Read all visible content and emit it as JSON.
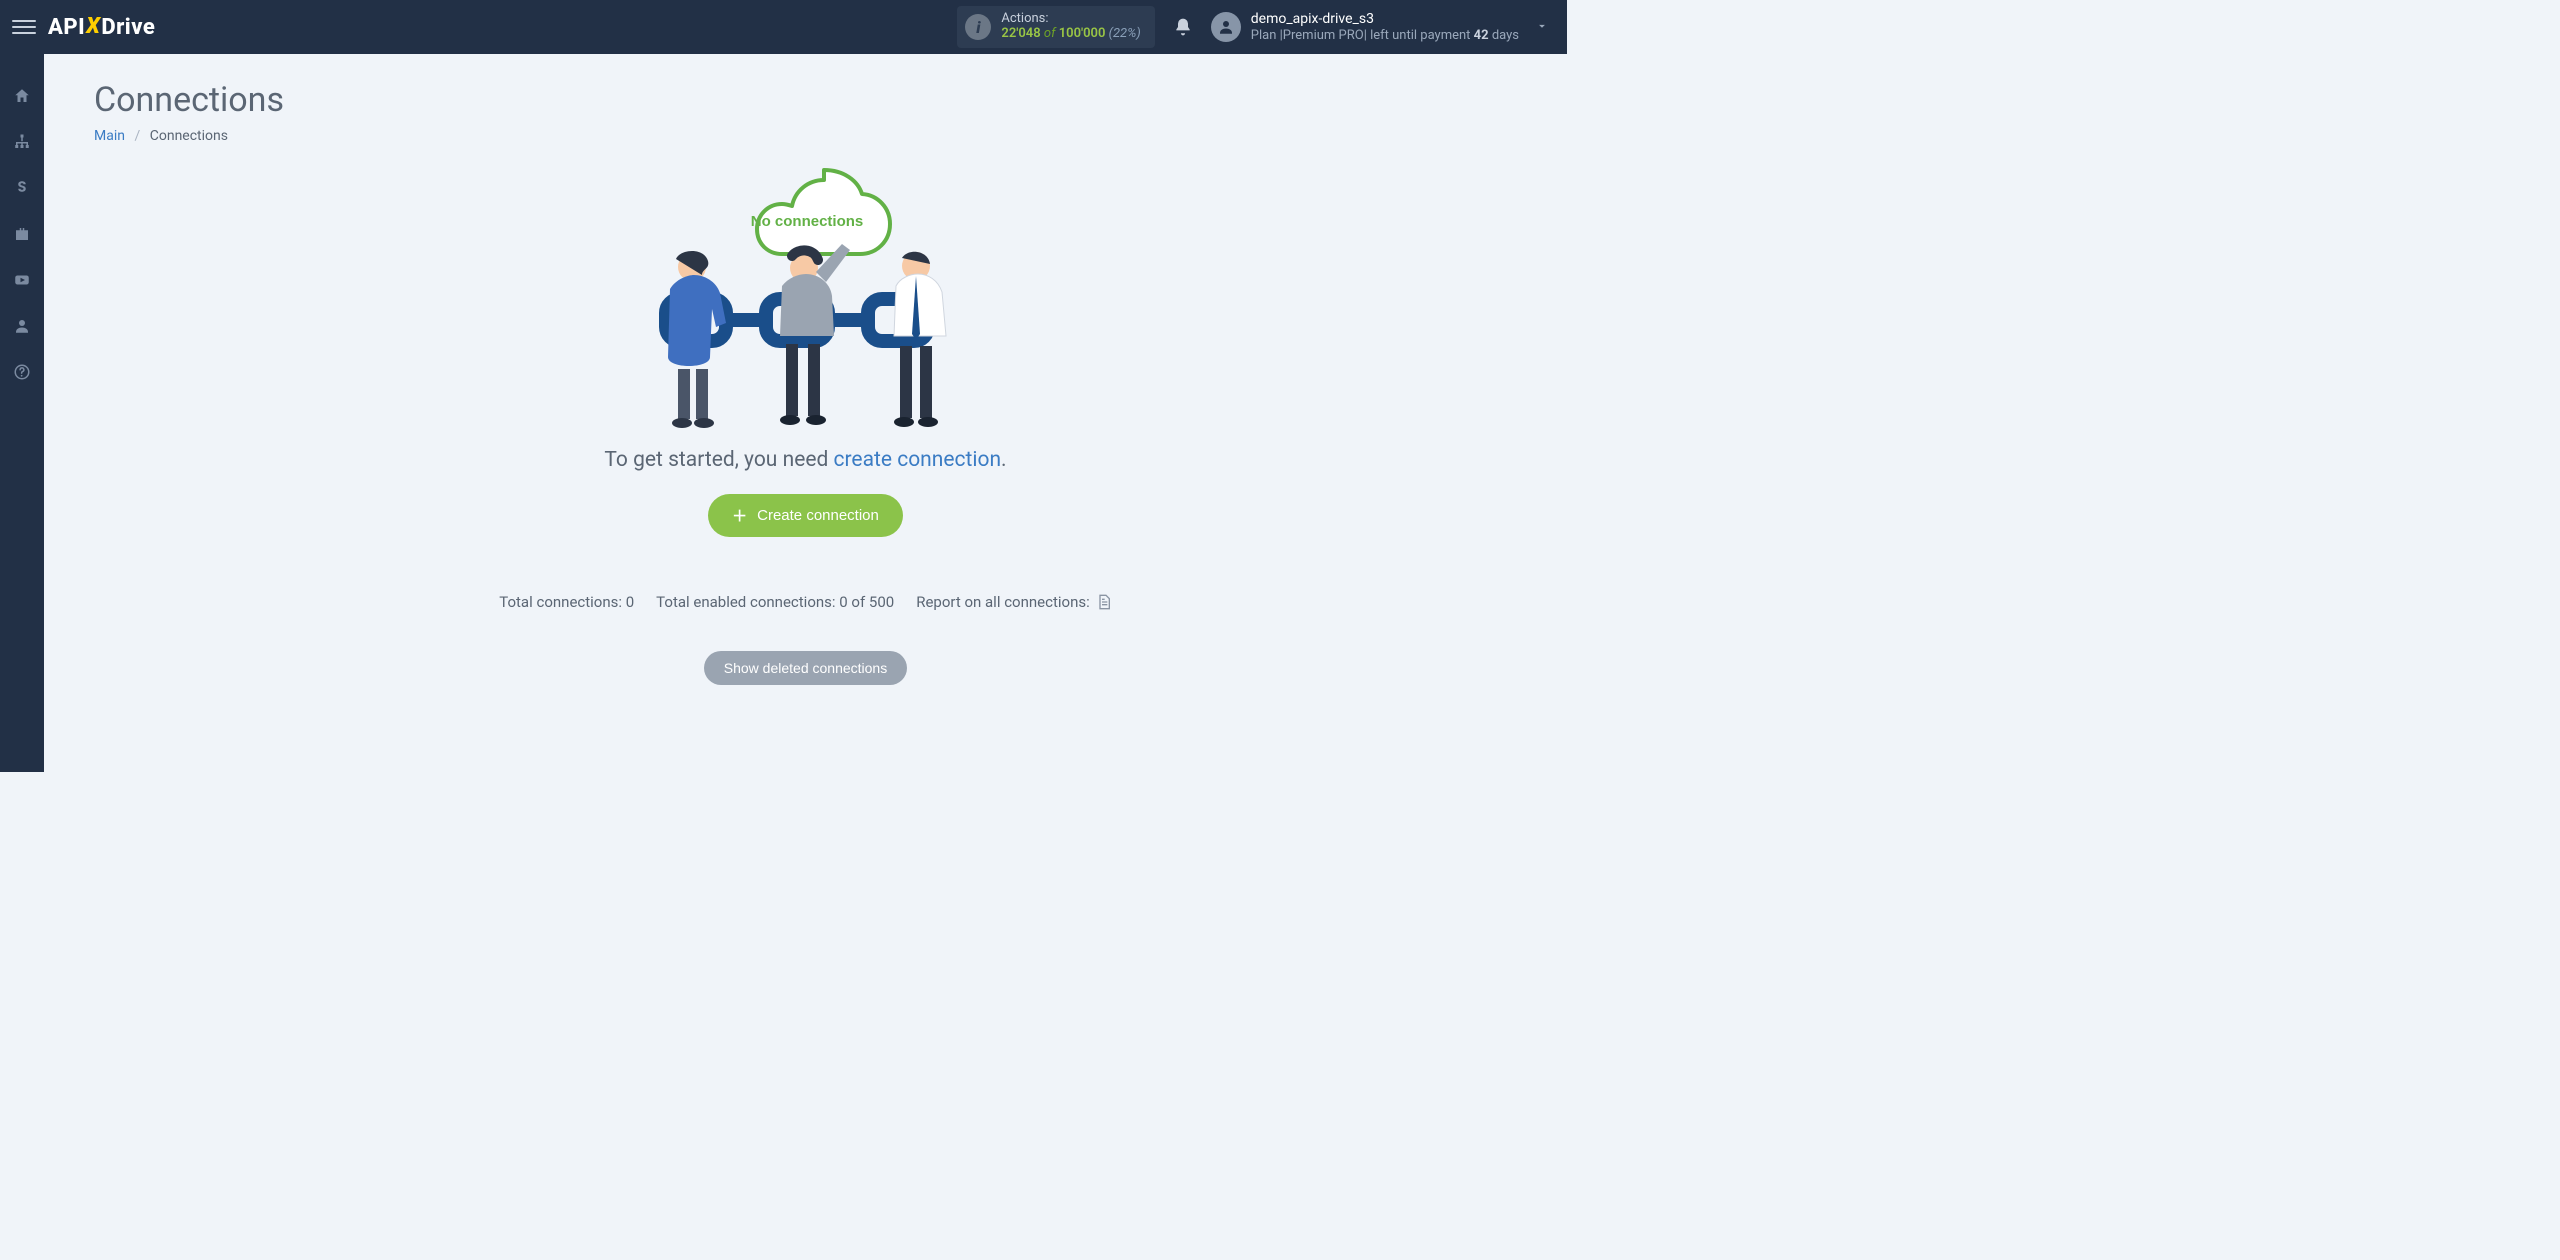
{
  "header": {
    "logo": {
      "part1": "API",
      "part2": "X",
      "part3": "Drive"
    },
    "actions": {
      "label": "Actions:",
      "used": "22'048",
      "of": "of",
      "total": "100'000",
      "percent": "(22%)"
    },
    "user": {
      "name": "demo_apix-drive_s3",
      "plan_prefix": "Plan |",
      "plan_name": "Premium PRO",
      "plan_mid": "| left until payment ",
      "days_bold": "42",
      "days_suffix": " days"
    }
  },
  "page": {
    "title": "Connections",
    "breadcrumb": {
      "main": "Main",
      "current": "Connections"
    },
    "cloud_text": "No connections",
    "lead_prefix": "To get started, you need ",
    "lead_link": "create connection",
    "lead_suffix": ".",
    "create_button": "Create connection",
    "stats": {
      "total_label": "Total connections: ",
      "total_value": "0",
      "enabled_label": "Total enabled connections: ",
      "enabled_value": "0 of 500",
      "report_label": "Report on all connections:"
    },
    "show_deleted": "Show deleted connections"
  }
}
